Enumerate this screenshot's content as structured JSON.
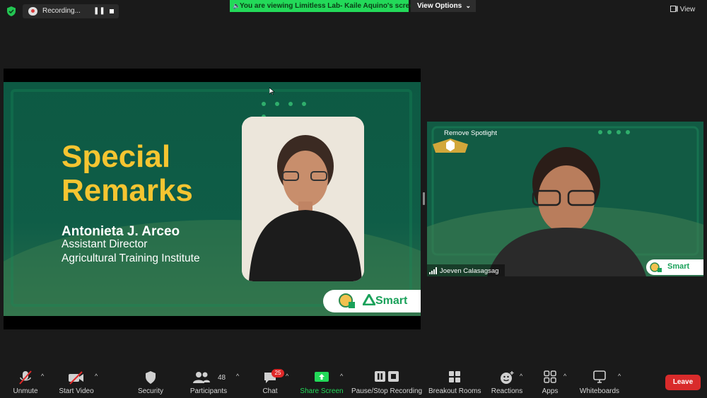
{
  "top_bar": {
    "recording_label": "Recording...",
    "viewing_banner": "You are viewing Limitless Lab- Kaile Aquino's screen",
    "view_options_label": "View Options",
    "view_label": "View"
  },
  "slide": {
    "title": "Special Remarks",
    "speaker_name": "Antonieta J. Arceo",
    "speaker_role": "Assistant Director",
    "speaker_org": "Agricultural Training Institute",
    "brand": "Smart"
  },
  "spotlight": {
    "label": "Remove Spotlight",
    "participant_name": "Joeven Calasagsag",
    "brand": "Smart"
  },
  "toolbar": {
    "unmute": "Unmute",
    "start_video": "Start Video",
    "security": "Security",
    "participants": "Participants",
    "participants_count": "48",
    "chat": "Chat",
    "chat_badge": "25",
    "share_screen": "Share Screen",
    "pause_stop_recording": "Pause/Stop Recording",
    "breakout_rooms": "Breakout Rooms",
    "reactions": "Reactions",
    "apps": "Apps",
    "whiteboards": "Whiteboards",
    "leave": "Leave"
  },
  "colors": {
    "background": "#1a1a1a",
    "banner_green": "#23d959",
    "slide_green": "#0e5a45",
    "title_yellow": "#f5c531",
    "leave_red": "#d92b2b",
    "smart_green": "#1aa15a"
  }
}
